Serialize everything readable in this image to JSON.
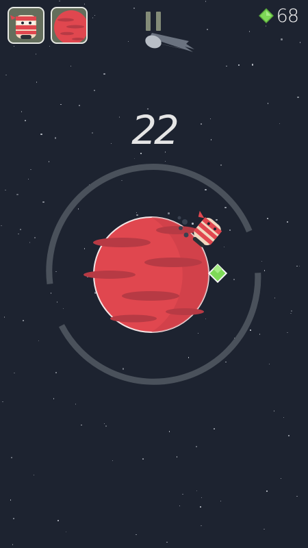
{
  "hud": {
    "score": "22",
    "gems": "68"
  },
  "icons": {
    "character_tile": "ninja-character-icon",
    "planet_tile": "red-planet-icon",
    "pause": "pause-icon",
    "gem": "green-gem-icon",
    "comet": "comet-icon",
    "player": "ninja-runner",
    "pickup": "green-gem-pickup"
  },
  "colors": {
    "background": "#1d2330",
    "planet": "#e0474f",
    "orbit_ring": "#4a515b",
    "gem": "#7ed957",
    "tile_bg": "#646e5c",
    "pause": "#838b78"
  }
}
